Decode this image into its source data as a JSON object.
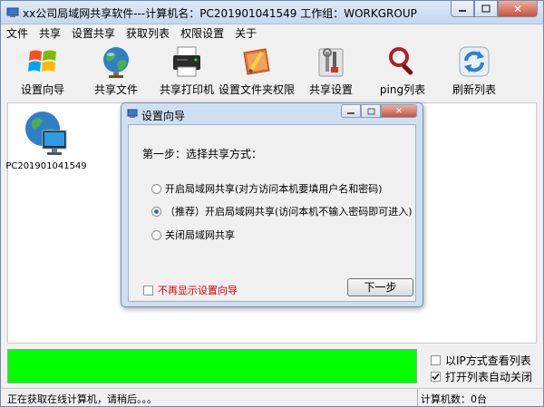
{
  "window": {
    "title": "xx公司局域网共享软件---计算机名：PC201901041549   工作组：WORKGROUP"
  },
  "menu": [
    "文件",
    "共享",
    "设置共享",
    "获取列表",
    "权限设置",
    "关于"
  ],
  "toolbar": [
    {
      "label": "设置向导",
      "icon": "windows-logo-icon"
    },
    {
      "label": "共享文件",
      "icon": "globe-icon"
    },
    {
      "label": "共享打印机",
      "icon": "printer-icon"
    },
    {
      "label": "设置文件夹权限",
      "icon": "folder-pencil-icon"
    },
    {
      "label": "共享设置",
      "icon": "tools-icon"
    },
    {
      "label": "ping列表",
      "icon": "magnifier-icon"
    },
    {
      "label": "刷新列表",
      "icon": "refresh-icon"
    }
  ],
  "computers": [
    {
      "name": "PC201901041549"
    }
  ],
  "dialog": {
    "title": "设置向导",
    "step": "第一步：选择共享方式：",
    "options": [
      {
        "label": "开启局域网共享(对方访问本机要填用户名和密码)",
        "selected": false
      },
      {
        "label": "（推荐）开启局域网共享(访问本机不输入密码即可进入)",
        "selected": true
      },
      {
        "label": "关闭局域网共享",
        "selected": false
      }
    ],
    "dont_show": "不再显示设置向导",
    "next": "下一步"
  },
  "options": {
    "ip_view": {
      "label": "以IP方式查看列表",
      "checked": false
    },
    "auto_close": {
      "label": "打开列表自动关闭",
      "checked": true
    }
  },
  "status": {
    "message": "正在获取在线计算机，请稍后。。。",
    "count": "计算机数：0台"
  },
  "colors": {
    "progress": "#00ff00",
    "warning_text": "#e00000"
  }
}
